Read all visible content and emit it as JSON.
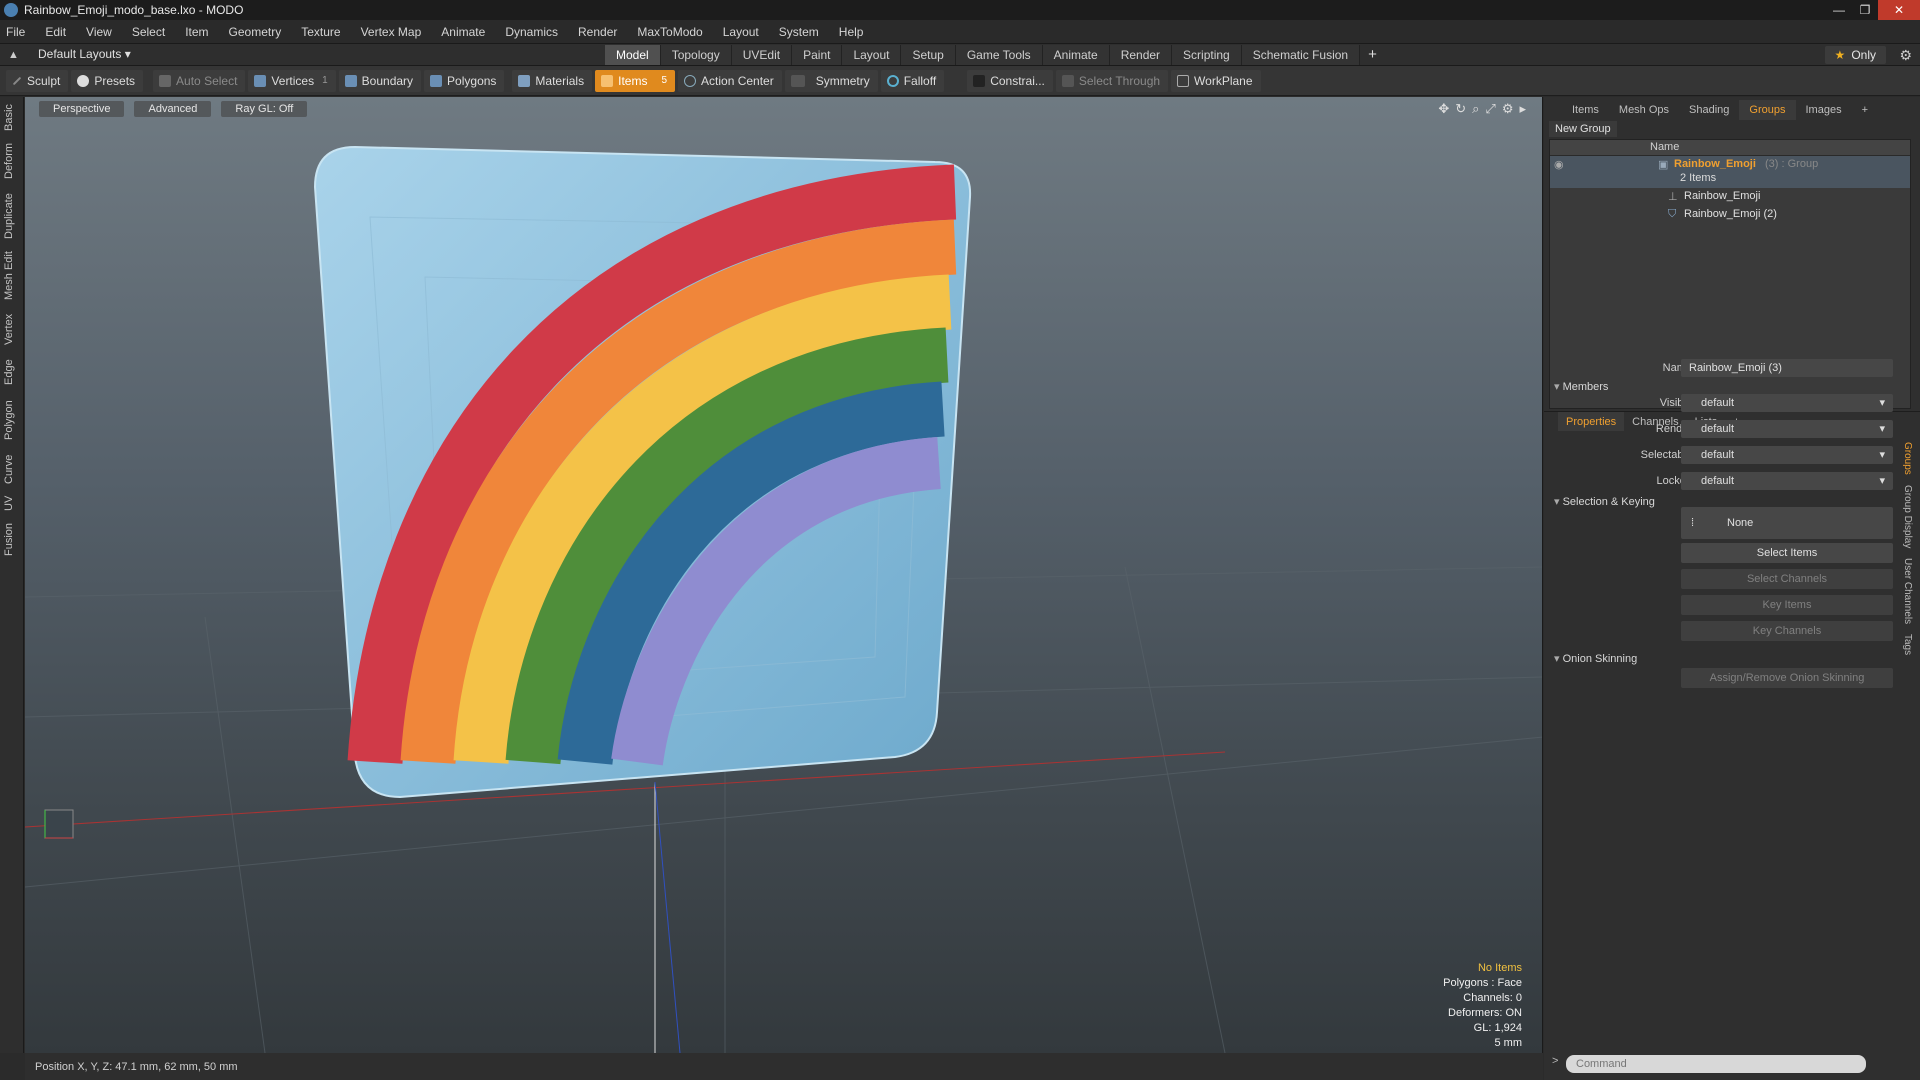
{
  "window": {
    "title": "Rainbow_Emoji_modo_base.lxo - MODO"
  },
  "menu": [
    "File",
    "Edit",
    "View",
    "Select",
    "Item",
    "Geometry",
    "Texture",
    "Vertex Map",
    "Animate",
    "Dynamics",
    "Render",
    "MaxToModo",
    "Layout",
    "System",
    "Help"
  ],
  "layoutbar": {
    "layout_select": "Default Layouts ▾",
    "tabs": [
      "Model",
      "Topology",
      "UVEdit",
      "Paint",
      "Layout",
      "Setup",
      "Game Tools",
      "Animate",
      "Render",
      "Scripting",
      "Schematic Fusion"
    ],
    "active_tab": "Model",
    "only_label": "Only"
  },
  "toolbar": {
    "sculpt": "Sculpt",
    "presets": "Presets",
    "auto_select": "Auto Select",
    "vertices": "Vertices",
    "vertices_count": "1",
    "boundary": "Boundary",
    "polygons": "Polygons",
    "materials": "Materials",
    "items": "Items",
    "items_count": "5",
    "action_center": "Action Center",
    "symmetry": "Symmetry",
    "falloff": "Falloff",
    "constraints": "Constrai...",
    "select_through": "Select Through",
    "workplane": "WorkPlane"
  },
  "left_tabs": [
    "Basic",
    "Deform",
    "Duplicate",
    "Mesh Edit",
    "Vertex",
    "Edge",
    "Polygon",
    "Curve",
    "UV",
    "Fusion"
  ],
  "viewport": {
    "projection": "Perspective",
    "shading": "Advanced",
    "raygl": "Ray GL: Off",
    "info": {
      "items": "No Items",
      "polygons": "Polygons : Face",
      "channels": "Channels: 0",
      "deformers": "Deformers: ON",
      "gl": "GL: 1,924",
      "scale": "5 mm"
    }
  },
  "status": {
    "position": "Position X, Y, Z:   47.1 mm, 62 mm, 50 mm"
  },
  "right_panel": {
    "tabs": [
      "Items",
      "Mesh Ops",
      "Shading",
      "Groups",
      "Images",
      "+"
    ],
    "active_tab": "Groups",
    "new_group": "New Group",
    "column_name": "Name",
    "group": {
      "name": "Rainbow_Emoji",
      "suffix": "(3) : Group",
      "count": "2 Items"
    },
    "children": [
      "Rainbow_Emoji",
      "Rainbow_Emoji (2)"
    ]
  },
  "properties": {
    "tabs": [
      "Properties",
      "Channels",
      "Lists",
      "+"
    ],
    "name_label": "Name",
    "name_value": "Rainbow_Emoji (3)",
    "members": "Members",
    "visible_label": "Visible",
    "visible_value": "default",
    "render_label": "Render",
    "render_value": "default",
    "selectable_label": "Selectable",
    "selectable_value": "default",
    "locked_label": "Locked",
    "locked_value": "default",
    "selection_keying": "Selection & Keying",
    "none_btn": "None",
    "select_items": "Select Items",
    "select_channels": "Select Channels",
    "key_items": "Key Items",
    "key_channels": "Key Channels",
    "onion": "Onion Skinning",
    "onion_btn": "Assign/Remove Onion Skinning",
    "side_tabs": [
      "Groups",
      "Group Display",
      "User Channels",
      "Tags"
    ],
    "command_placeholder": "Command"
  }
}
